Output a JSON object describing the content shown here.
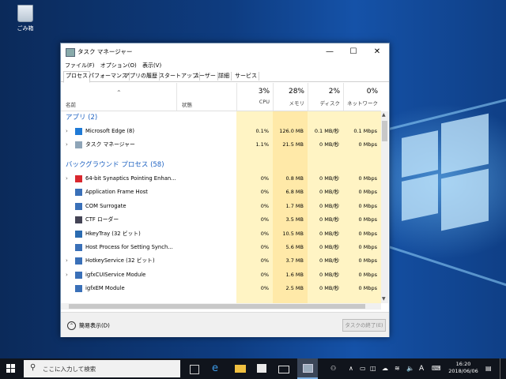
{
  "desktop": {
    "recycle_bin_label": "ごみ箱"
  },
  "window": {
    "title": "タスク マネージャー",
    "controls": {
      "minimize": "—",
      "maximize": "☐",
      "close": "✕"
    },
    "menu": [
      "ファイル(F)",
      "オプション(O)",
      "表示(V)"
    ],
    "tabs": [
      "プロセス",
      "パフォーマンス",
      "アプリの履歴",
      "スタートアップ",
      "ユーザー",
      "詳細",
      "サービス"
    ],
    "active_tab": "プロセス",
    "columns": {
      "name": "名前",
      "status": "状態",
      "sort_indicator": "⌃",
      "cpu": {
        "pct": "3%",
        "label": "CPU"
      },
      "memory": {
        "pct": "28%",
        "label": "メモリ"
      },
      "disk": {
        "pct": "2%",
        "label": "ディスク"
      },
      "network": {
        "pct": "0%",
        "label": "ネットワーク"
      }
    },
    "groups": {
      "apps": "アプリ (2)",
      "background": "バックグラウンド プロセス (58)"
    },
    "apps": [
      {
        "name": "Microsoft Edge (8)",
        "icon": "edge-icon",
        "expandable": true,
        "cpu": "0.1%",
        "mem": "126.0 MB",
        "disk": "0.1 MB/秒",
        "net": "0.1 Mbps"
      },
      {
        "name": "タスク マネージャー",
        "icon": "task-manager-icon",
        "expandable": true,
        "cpu": "1.1%",
        "mem": "21.5 MB",
        "disk": "0 MB/秒",
        "net": "0 Mbps"
      }
    ],
    "background": [
      {
        "name": "64-bit Synaptics Pointing Enhan...",
        "icon": "synaptics-icon",
        "expandable": true,
        "cpu": "0%",
        "mem": "0.8 MB",
        "disk": "0 MB/秒",
        "net": "0 Mbps"
      },
      {
        "name": "Application Frame Host",
        "icon": "app-frame-icon",
        "expandable": false,
        "cpu": "0%",
        "mem": "6.8 MB",
        "disk": "0 MB/秒",
        "net": "0 Mbps"
      },
      {
        "name": "COM Surrogate",
        "icon": "com-surrogate-icon",
        "expandable": false,
        "cpu": "0%",
        "mem": "1.7 MB",
        "disk": "0 MB/秒",
        "net": "0 Mbps"
      },
      {
        "name": "CTF ローダー",
        "icon": "ctf-icon",
        "expandable": false,
        "cpu": "0%",
        "mem": "3.5 MB",
        "disk": "0 MB/秒",
        "net": "0 Mbps"
      },
      {
        "name": "HkeyTray (32 ビット)",
        "icon": "hkeytray-icon",
        "expandable": false,
        "cpu": "0%",
        "mem": "10.5 MB",
        "disk": "0 MB/秒",
        "net": "0 Mbps"
      },
      {
        "name": "Host Process for Setting Synch...",
        "icon": "host-process-icon",
        "expandable": false,
        "cpu": "0%",
        "mem": "5.6 MB",
        "disk": "0 MB/秒",
        "net": "0 Mbps"
      },
      {
        "name": "HotkeyService (32 ビット)",
        "icon": "hotkey-service-icon",
        "expandable": true,
        "cpu": "0%",
        "mem": "3.7 MB",
        "disk": "0 MB/秒",
        "net": "0 Mbps"
      },
      {
        "name": "igfxCUIService Module",
        "icon": "igfx-cui-icon",
        "expandable": true,
        "cpu": "0%",
        "mem": "1.6 MB",
        "disk": "0 MB/秒",
        "net": "0 Mbps"
      },
      {
        "name": "igfxEM Module",
        "icon": "igfx-em-icon",
        "expandable": false,
        "cpu": "0%",
        "mem": "2.5 MB",
        "disk": "0 MB/秒",
        "net": "0 Mbps"
      }
    ],
    "footer": {
      "fewer_details": "簡易表示(D)",
      "end_task": "タスクの終了(E)"
    }
  },
  "taskbar": {
    "search_placeholder": "ここに入力して検索",
    "ime": "A",
    "time": "16:20",
    "date": "2018/06/06"
  },
  "colors": {
    "cpu_col": "#fff4c4",
    "mem_col": "#ffe9a8",
    "accent": "#1e62c2"
  }
}
